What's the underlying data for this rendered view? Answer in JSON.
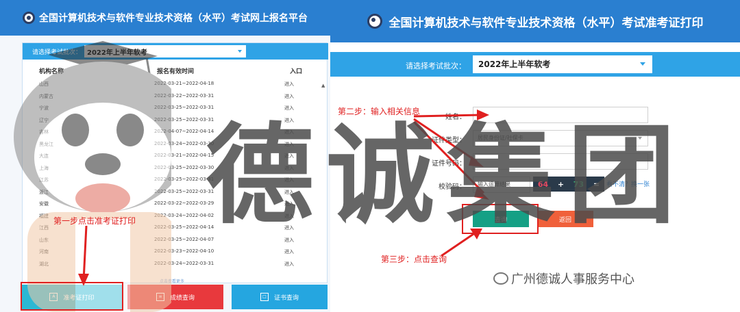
{
  "left": {
    "title": "全国计算机技术与软件专业技术资格（水平）考试网上报名平台",
    "batch_label": "请选择考试批次：",
    "batch_value": "2022年上半年软考",
    "columns": [
      "机构名称",
      "报名有效时间",
      "入口"
    ],
    "rows": [
      {
        "name": "山西",
        "time": "2022-03-21~2022-04-18",
        "entry": "进入"
      },
      {
        "name": "内蒙古",
        "time": "2022-03-22~2022-03-31",
        "entry": "进入"
      },
      {
        "name": "宁波",
        "time": "2022-03-25~2022-03-31",
        "entry": "进入"
      },
      {
        "name": "辽宁",
        "time": "2022-03-25~2022-03-31",
        "entry": "进入"
      },
      {
        "name": "吉林",
        "time": "2022-04-07~2022-04-14",
        "entry": "进入"
      },
      {
        "name": "黑龙江",
        "time": "2022-03-24~2022-03-30",
        "entry": "进入"
      },
      {
        "name": "大连",
        "time": "2022-03-21~2022-04-15",
        "entry": "进入"
      },
      {
        "name": "上海",
        "time": "2022-03-25~2022-03-30",
        "entry": "进入"
      },
      {
        "name": "江苏",
        "time": "2022-03-25~2022-03-31",
        "entry": "进入"
      },
      {
        "name": "浙江",
        "time": "2022-03-25~2022-03-31",
        "entry": "进入"
      },
      {
        "name": "安徽",
        "time": "2022-03-22~2022-03-29",
        "entry": "进入"
      },
      {
        "name": "福建",
        "time": "2022-03-24~2022-04-02",
        "entry": "进入"
      },
      {
        "name": "江西",
        "time": "2022-03-25~2022-04-14",
        "entry": "进入"
      },
      {
        "name": "山东",
        "time": "2022-03-25~2022-04-07",
        "entry": "进入"
      },
      {
        "name": "河南",
        "time": "2022-03-23~2022-04-10",
        "entry": "进入"
      },
      {
        "name": "湖北",
        "time": "2022-03-24~2022-03-31",
        "entry": "进入"
      }
    ],
    "more_tip": "点击查看更多",
    "footer": {
      "admit_label": "准考证打印",
      "score_label": "成绩查询",
      "cert_label": "证书查询"
    }
  },
  "right": {
    "title": "全国计算机技术与软件专业技术资格（水平）考试准考证打印",
    "batch_label": "请选择考试批次：",
    "batch_value": "2022年上半年软考",
    "form": {
      "name_label": "姓名：",
      "idtype_label": "证件类型：",
      "idtype_value": "居民身份证/社保卡",
      "idno_label": "证件号码：",
      "captcha_label": "校验码：",
      "captcha_placeholder": "输入运算结果",
      "captcha_a": "64",
      "captcha_op": "+",
      "captcha_b": "73",
      "captcha_eq": "=",
      "refresh_label": "看不清？换一张"
    },
    "query_label": "查询",
    "back_label": "返回",
    "wechat_text": "广州德诚人事服务中心"
  },
  "annotations": {
    "step1": "第一步点击准考证打印",
    "step2": "第二步：输入相关信息",
    "step3": "第三步：点击查询"
  },
  "watermark": "德诚集团",
  "colors": {
    "header_blue": "#2a7fd0",
    "bar_blue": "#2fa3e6",
    "admit_cyan": "#2cb8d4",
    "score_red": "#e8393d",
    "cert_cyan": "#25a6e0",
    "query_teal": "#15a085",
    "back_orange": "#f0603a",
    "annotation_red": "#e02020"
  }
}
